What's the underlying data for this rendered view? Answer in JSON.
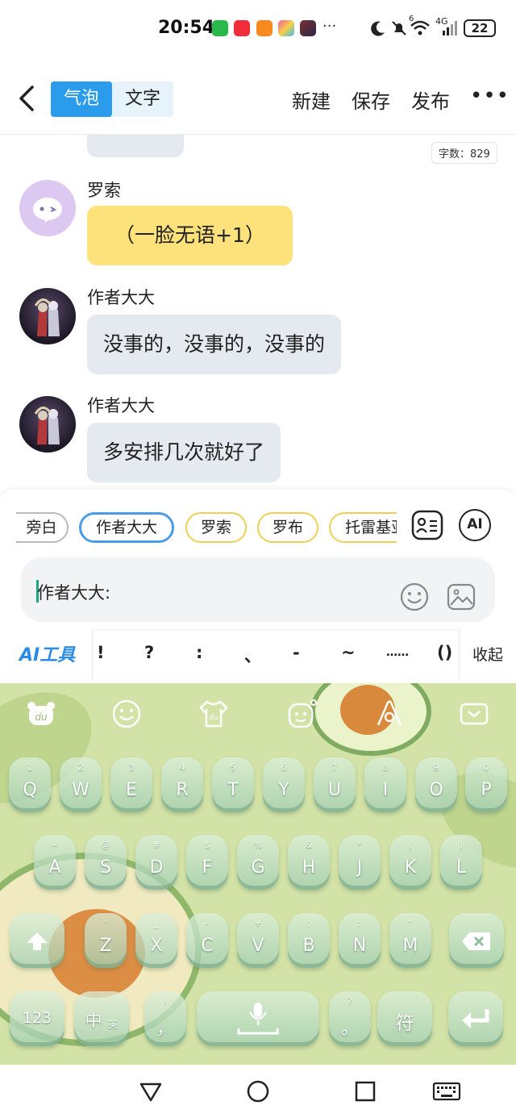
{
  "status": {
    "time": "20:54",
    "more": "···",
    "net1": "6",
    "net2": "4G",
    "battery": "22"
  },
  "header": {
    "toggle_bubble": "气泡",
    "toggle_text": "文字",
    "new_label": "新建",
    "save_label": "保存",
    "publish_label": "发布",
    "more_label": "•••"
  },
  "chat": {
    "word_count": "字数：829",
    "messages": [
      {
        "name": "罗索",
        "text": "（一脸无语+1）"
      },
      {
        "name": "作者大大",
        "text": "没事的，没事的，没事的"
      },
      {
        "name": "作者大大",
        "text": "多安排几次就好了"
      }
    ]
  },
  "editor": {
    "roles": [
      "旁白",
      "作者大大",
      "罗索",
      "罗布",
      "托雷基亚"
    ],
    "ai_icon_label": "AI",
    "input_value": "作者大大:",
    "ai_tool_label": "AI工具",
    "punctuation": [
      "!",
      "?",
      ":",
      "、",
      "-",
      "~",
      "……",
      "()"
    ],
    "collapse_label": "收起"
  },
  "keyboard": {
    "row1": [
      {
        "main": "Q",
        "sub": "1"
      },
      {
        "main": "W",
        "sub": "2"
      },
      {
        "main": "E",
        "sub": "3"
      },
      {
        "main": "R",
        "sub": "4"
      },
      {
        "main": "T",
        "sub": "5"
      },
      {
        "main": "Y",
        "sub": "6"
      },
      {
        "main": "U",
        "sub": "7"
      },
      {
        "main": "I",
        "sub": "8"
      },
      {
        "main": "O",
        "sub": "9"
      },
      {
        "main": "P",
        "sub": "0"
      }
    ],
    "row2": [
      {
        "main": "A",
        "sub": "~"
      },
      {
        "main": "S",
        "sub": "@"
      },
      {
        "main": "D",
        "sub": "#"
      },
      {
        "main": "F",
        "sub": "$"
      },
      {
        "main": "G",
        "sub": "%"
      },
      {
        "main": "H",
        "sub": "&"
      },
      {
        "main": "J",
        "sub": "*"
      },
      {
        "main": "K",
        "sub": "("
      },
      {
        "main": "L",
        "sub": ")"
      }
    ],
    "row3": [
      {
        "main": "Z",
        "sub": "'"
      },
      {
        "main": "X",
        "sub": "_"
      },
      {
        "main": "C",
        "sub": "-"
      },
      {
        "main": "V",
        "sub": "+"
      },
      {
        "main": "B",
        "sub": ";"
      },
      {
        "main": "N",
        "sub": ":"
      },
      {
        "main": "M",
        "sub": "\""
      }
    ],
    "num_label": "123",
    "zh_label": "中",
    "zh_sub": "英",
    "comma_label": "，",
    "comma_sub": "!",
    "period_label": "。",
    "period_sub": "?",
    "symbol_label": "符"
  }
}
